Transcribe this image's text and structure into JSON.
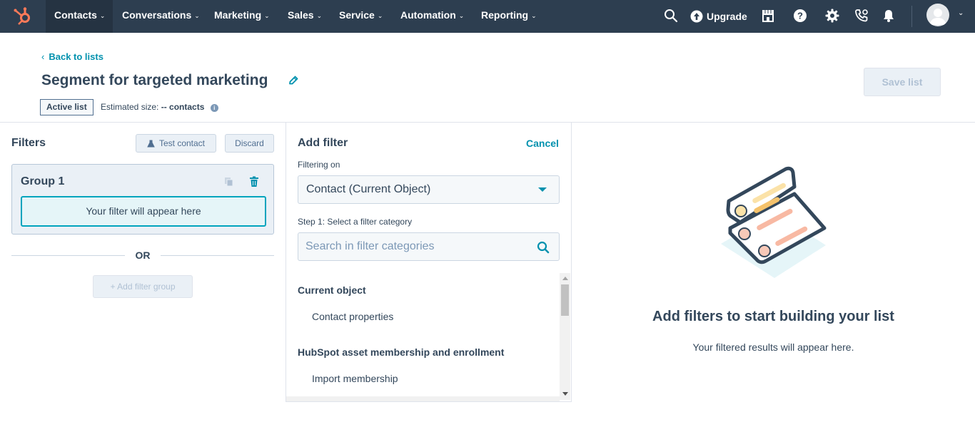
{
  "topnav": {
    "items": [
      {
        "label": "Contacts",
        "active": true
      },
      {
        "label": "Conversations"
      },
      {
        "label": "Marketing"
      },
      {
        "label": "Sales"
      },
      {
        "label": "Service"
      },
      {
        "label": "Automation"
      },
      {
        "label": "Reporting"
      }
    ],
    "upgrade_label": "Upgrade",
    "icons": [
      "search-icon",
      "marketplace-icon",
      "help-icon",
      "settings-icon",
      "calling-icon",
      "notifications-icon"
    ],
    "background_color": "#2d3e50",
    "brand_color": "#ff7a59"
  },
  "header": {
    "back_label": "Back to lists",
    "title": "Segment for targeted marketing",
    "list_type_tag": "Active list",
    "estimated_size_label": "Estimated size:",
    "estimated_size_value": "-- contacts",
    "save_label": "Save list"
  },
  "filters_panel": {
    "title": "Filters",
    "test_contact_label": "Test contact",
    "discard_label": "Discard",
    "group_title": "Group 1",
    "filter_placeholder": "Your filter will appear here",
    "or_label": "OR",
    "add_group_label": "+ Add filter group"
  },
  "add_filter_panel": {
    "title": "Add filter",
    "cancel_label": "Cancel",
    "filtering_on_label": "Filtering on",
    "filtering_on_value": "Contact (Current Object)",
    "step1_label": "Step 1: Select a filter category",
    "search_placeholder": "Search in filter categories",
    "sections": [
      {
        "heading": "Current object",
        "items": [
          "Contact properties"
        ]
      },
      {
        "heading": "HubSpot asset membership and enrollment",
        "items": [
          "Import membership"
        ]
      }
    ]
  },
  "empty_state": {
    "title": "Add filters to start building your list",
    "subtitle": "Your filtered results will appear here."
  },
  "colors": {
    "accent_link": "#0091ae",
    "teal_border": "#00a4bd",
    "text_primary": "#33475b"
  }
}
